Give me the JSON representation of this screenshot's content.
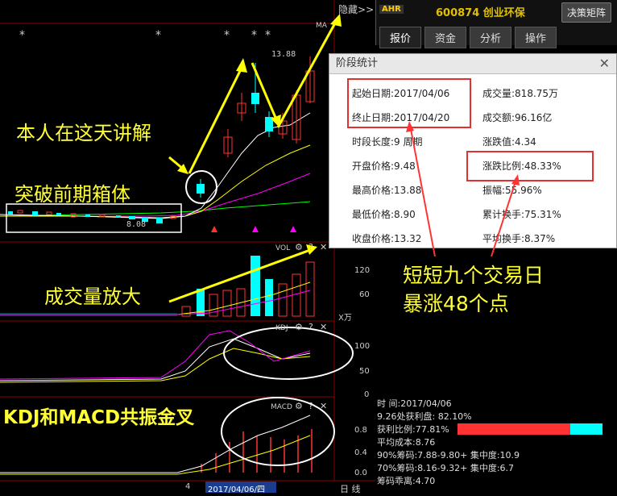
{
  "header": {
    "hide_label": "隐藏",
    "hide_arrows": ">>",
    "symbol": "AHR",
    "code_name": "600874 创业环保",
    "decision_button": "决策矩阵",
    "tabs": [
      "报价",
      "资金",
      "分析",
      "操作"
    ]
  },
  "chart": {
    "ma_label": "MA",
    "high_label": "13.88",
    "low_label": "8.08",
    "vol_label": "VOL",
    "kdj_label": "KDJ",
    "macd_label": "MACD",
    "vol_axis": [
      "120",
      "60",
      "X万"
    ],
    "kdj_axis": [
      "100",
      "50",
      "0"
    ],
    "macd_axis": [
      "0.8",
      "0.4",
      "0.0"
    ],
    "x_labels": [
      "4",
      "2017/04/06/四",
      "日 线"
    ],
    "stars": [
      "*",
      "*",
      "*",
      "*",
      "*"
    ],
    "colors": {
      "up": "#ff3333",
      "down": "#00ffff",
      "ma5": "#ffffff",
      "ma10": "#ffff00",
      "ma20": "#ff00ff",
      "ma60": "#00ff00"
    }
  },
  "dialog": {
    "title": "阶段统计",
    "close": "✕",
    "stats": {
      "start": "起始日期:2017/04/06",
      "end": "终止日期:2017/04/20",
      "length": "时段长度:9 周期",
      "open": "开盘价格:9.48",
      "high": "最高价格:13.88",
      "low": "最低价格:8.90",
      "close": "收盘价格:13.32",
      "volume": "成交量:818.75万",
      "amount": "成交额:96.16亿",
      "change": "涨跌值:4.34",
      "change_pct": "涨跌比例:48.33%",
      "amplitude": "振幅:55.96%",
      "turnover_total": "累计换手:75.31%",
      "turnover_avg": "平均换手:8.37%"
    }
  },
  "annotations": {
    "explain": "本人在这天讲解",
    "breakout": "突破前期箱体",
    "volume": "成交量放大",
    "surge_line1": "短短九个交易日",
    "surge_line2": "暴涨48个点",
    "kdj_macd": "KDJ和MACD共振金叉"
  },
  "chip_info": {
    "time": "时        间:2017/04/06",
    "profit_price": "9.26处获利盘: 82.10%",
    "profit_ratio": "获利比例:77.81%",
    "avg_cost": "平均成本:8.76",
    "chip90": "90%筹码:7.88-9.80+ 集中度:10.9",
    "chip70": "70%筹码:8.16-9.32+ 集中度:6.7",
    "deviation": "筹码乖离:4.70",
    "profit_fraction": 0.7781
  }
}
